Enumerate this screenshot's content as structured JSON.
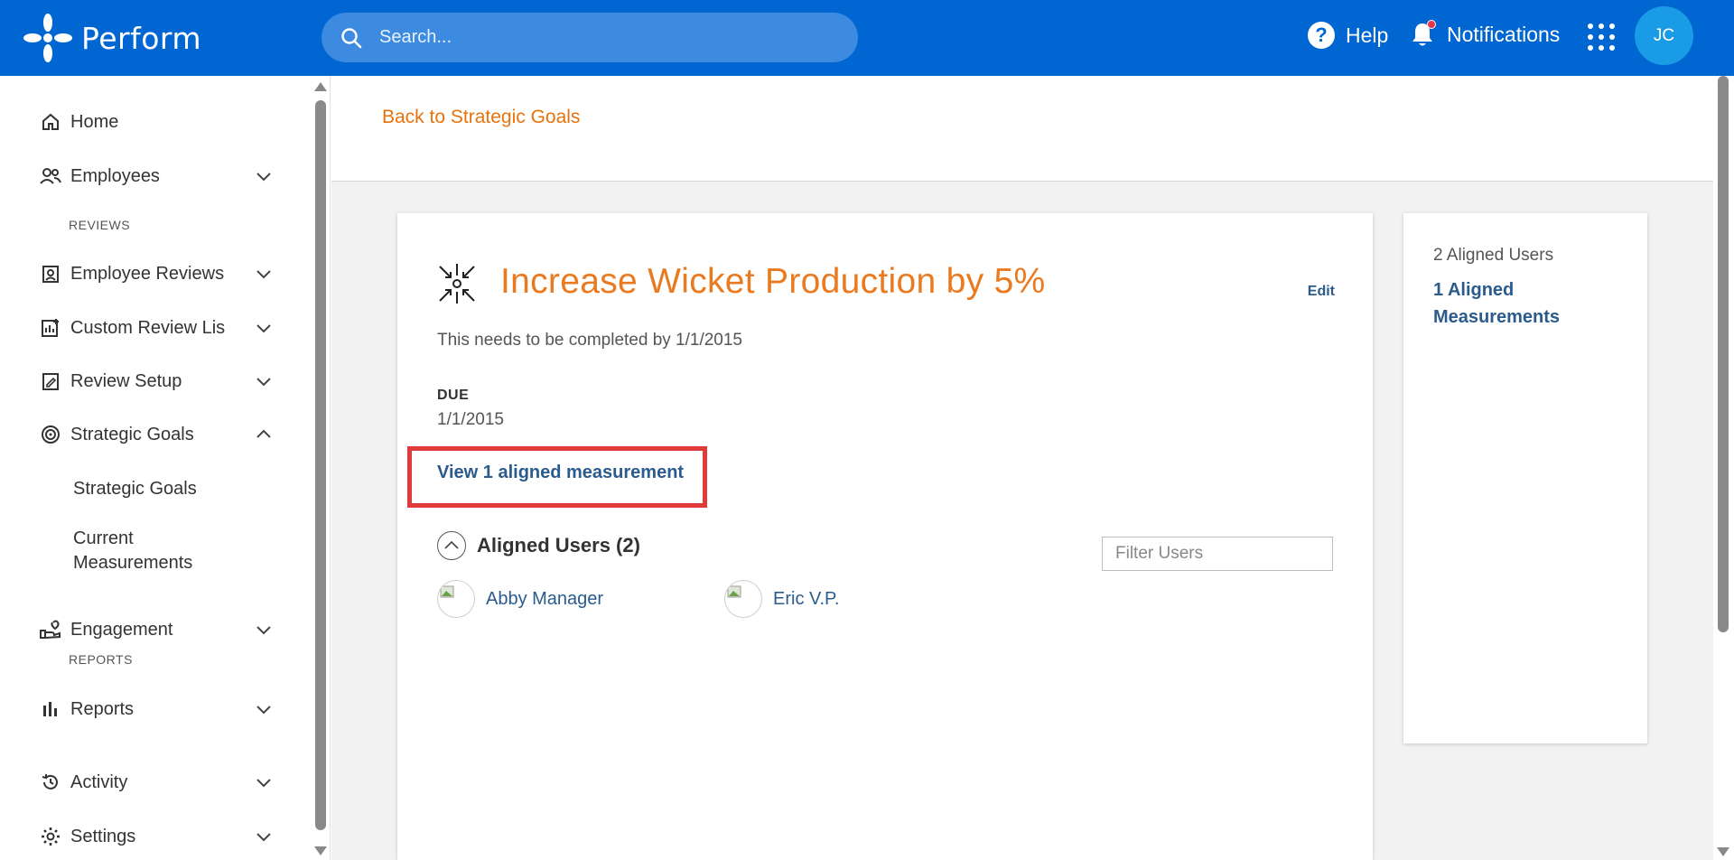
{
  "header": {
    "brand": "Perform",
    "search_placeholder": "Search...",
    "help": "Help",
    "notifications": "Notifications",
    "avatar_initials": "JC"
  },
  "sidebar": {
    "home": "Home",
    "employees": "Employees",
    "section_reviews": "REVIEWS",
    "employee_reviews": "Employee Reviews",
    "custom_review_lists": "Custom Review Lis",
    "review_setup": "Review Setup",
    "strategic_goals": "Strategic Goals",
    "sub_strategic_goals": "Strategic Goals",
    "sub_current_measurements_1": "Current",
    "sub_current_measurements_2": "Measurements",
    "engagement": "Engagement",
    "section_reports": "REPORTS",
    "reports": "Reports",
    "activity": "Activity",
    "settings": "Settings"
  },
  "main": {
    "back_link": "Back to Strategic Goals",
    "goal_title": "Increase Wicket Production by 5%",
    "edit": "Edit",
    "description": "This needs to be completed by 1/1/2015",
    "due_label": "DUE",
    "due_value": "1/1/2015",
    "view_link": "View 1 aligned measurement",
    "aligned_users_heading": "Aligned Users (2)",
    "filter_placeholder": "Filter Users",
    "users": [
      "Abby Manager",
      "Eric V.P."
    ]
  },
  "side_panel": {
    "aligned_users": "2 Aligned Users",
    "aligned_measurements_1": "1 Aligned",
    "aligned_measurements_2": "Measurements"
  },
  "colors": {
    "header_bg": "#0066d1",
    "accent_orange": "#ea7a1f",
    "link_blue": "#2a5b8c",
    "highlight_red": "#e03a3a"
  }
}
